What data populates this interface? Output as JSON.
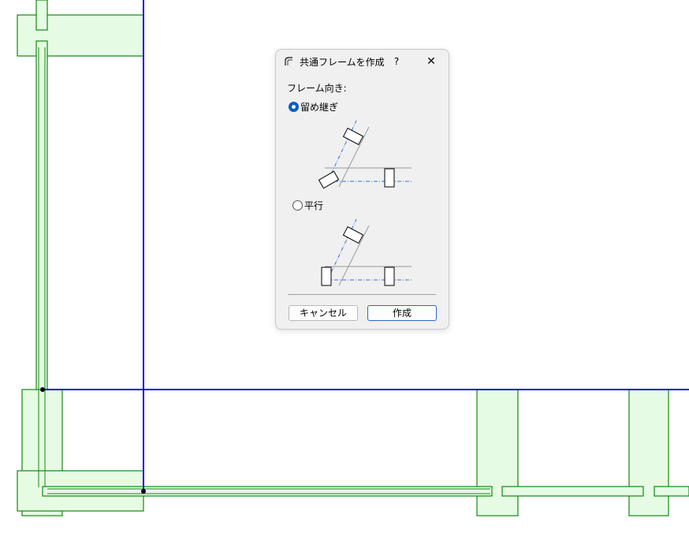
{
  "dialog": {
    "title": "共通フレームを作成",
    "help_label": "?",
    "close_label": "✕",
    "orientation_label": "フレーム向き:",
    "options": [
      {
        "label": "留め継ぎ",
        "selected": true
      },
      {
        "label": "平行",
        "selected": false
      }
    ],
    "cancel_label": "キャンセル",
    "create_label": "作成"
  },
  "colors": {
    "wall_fill": "#e6fbe3",
    "wall_stroke": "#118811",
    "axis_line": "#0000ee",
    "dialog_bg": "#f0f0f0",
    "accent": "#0a5ec2"
  }
}
